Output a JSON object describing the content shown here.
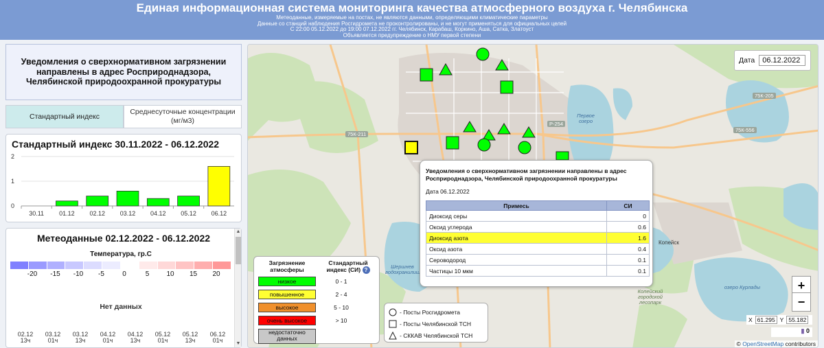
{
  "header": {
    "title": "Единая информационная система мониторинга качества атмосферного воздуха г. Челябинска",
    "sub1": "Метеоданные, измеряемые на постах, не являются данными, определяющими климатические параметры",
    "sub2": "Данные со станций наблюдения Росгидромета не проконтролированы, и не могут применяться для официальных целей",
    "sub3": "С 22:00 05.12.2022 до 19:00 07.12.2022 гг. Челябинск, Карабаш, Коркино, Аша, Сатка, Златоуст",
    "sub4": "Объявляется предупреждение о НМУ первой степени"
  },
  "notice": "Уведомления о сверхнормативном загрязнении направлены в адрес Росприроднадзора, Челябинской природоохранной прокуратуры",
  "tabs": [
    {
      "label": "Стандартный индекс",
      "active": true
    },
    {
      "label": "Среднесуточные концентрации (мг/м3)",
      "active": false
    }
  ],
  "index_panel": {
    "title": "Стандартный индекс 30.11.2022 - 06.12.2022"
  },
  "chart_data": {
    "type": "bar",
    "categories": [
      "30.11",
      "01.12",
      "02.12",
      "03.12",
      "04.12",
      "05.12",
      "06.12"
    ],
    "values": [
      0,
      0.2,
      0.4,
      0.6,
      0.3,
      0.4,
      1.6
    ],
    "colors": [
      "#00ff00",
      "#00ff00",
      "#00ff00",
      "#00ff00",
      "#00ff00",
      "#00ff00",
      "#ffff00"
    ],
    "yticks": [
      "0",
      "1",
      "2"
    ],
    "ylim": [
      0,
      2
    ],
    "title": "Стандартный индекс 30.11.2022 - 06.12.2022",
    "xlabel": "",
    "ylabel": ""
  },
  "meteo_panel": {
    "title": "Метеоданные 02.12.2022 - 06.12.2022",
    "temp_label": "Температура, гр.С",
    "temp_ticks": [
      "-20",
      "-15",
      "-10",
      "-5",
      "0",
      "5",
      "10",
      "15",
      "20"
    ],
    "temp_colors": [
      "#8080ff",
      "#9a9aff",
      "#b0b0ff",
      "#c8c8ff",
      "#dcdcff",
      "#ececff",
      "#ffffff",
      "#ffeaea",
      "#ffd8d8",
      "#ffc4c4",
      "#ffaeae",
      "#ff9898"
    ],
    "no_data": "Нет данных",
    "times": [
      {
        "date": "02.12",
        "hour": "13ч"
      },
      {
        "date": "03.12",
        "hour": "01ч"
      },
      {
        "date": "03.12",
        "hour": "13ч"
      },
      {
        "date": "04.12",
        "hour": "01ч"
      },
      {
        "date": "04.12",
        "hour": "13ч"
      },
      {
        "date": "05.12",
        "hour": "01ч"
      },
      {
        "date": "05.12",
        "hour": "13ч"
      },
      {
        "date": "06.12",
        "hour": "01ч"
      }
    ]
  },
  "date_filter": {
    "label": "Дата",
    "value": "06.12.2022"
  },
  "popup": {
    "title": "Уведомления о сверхнормативном загрязнении направлены в адрес Росприроднадзора, Челябинской природоохранной прокуратуры",
    "date": "Дата 06.12.2022",
    "col_substance": "Примесь",
    "col_index": "СИ",
    "rows": [
      {
        "name": "Диоксид серы",
        "value": "0"
      },
      {
        "name": "Оксид углерода",
        "value": "0.6"
      },
      {
        "name": "Диоксид азота",
        "value": "1.6"
      },
      {
        "name": "Оксид азота",
        "value": "0.4"
      },
      {
        "name": "Сероводород",
        "value": "0.1"
      },
      {
        "name": "Частицы 10 мкм",
        "value": "0.1"
      }
    ]
  },
  "legend": {
    "col1": "Загрязнение атмосферы",
    "col2": "Стандартный индекс (СИ)",
    "help": "?",
    "rows": [
      {
        "label": "низкое",
        "range": "0 - 1",
        "color": "#00ff00"
      },
      {
        "label": "повышенное",
        "range": "2 - 4",
        "color": "#ffff33"
      },
      {
        "label": "высокое",
        "range": "5 - 10",
        "color": "#f0902c"
      },
      {
        "label": "очень высокое",
        "range": "> 10",
        "color": "#ff0000"
      },
      {
        "label": "недостаточно данных",
        "range": "",
        "color": "#c8c8c8"
      }
    ]
  },
  "station_legend": {
    "rosgidromet": "- Посты Росгидромета",
    "tsn": "- Посты Челябинской ТСН",
    "sckav": "- СККАВ Челябинской ТСН"
  },
  "map": {
    "zoom_in": "+",
    "zoom_out": "−",
    "coord_x_label": "X",
    "coord_x": "61.295",
    "coord_y_label": "Y",
    "coord_y": "55.182",
    "zoom_level": "0",
    "attribution_prefix": "©",
    "attribution_link": "OpenStreetMap",
    "attribution_suffix": "contributors",
    "labels": {
      "kopeisk": "Копейск",
      "pervoe_ozero": "Первое озеро",
      "shershnev": "Шершнев водохранилище",
      "kurlady": "озеро Курлады",
      "kopeisky_bor": "Копейский городской лесопарк",
      "r254": "Р-254",
      "r75k211": "75К-211",
      "r75k205": "75К-205",
      "r75k556": "75К-556"
    }
  }
}
